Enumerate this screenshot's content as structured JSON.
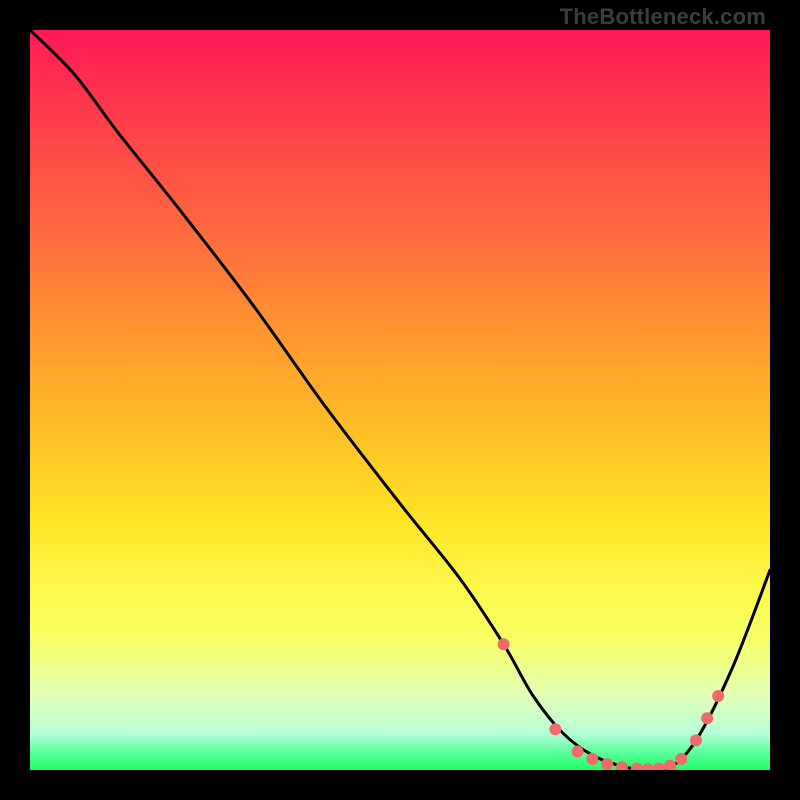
{
  "watermark": "TheBottleneck.com",
  "chart_data": {
    "type": "line",
    "title": "",
    "xlabel": "",
    "ylabel": "",
    "xlim": [
      0,
      100
    ],
    "ylim": [
      0,
      100
    ],
    "grid": false,
    "legend": false,
    "series": [
      {
        "name": "bottleneck-curve",
        "color": "#000000",
        "x": [
          0,
          6,
          12,
          20,
          30,
          40,
          50,
          58,
          64,
          68,
          72,
          76,
          80,
          83,
          86,
          90,
          95,
          100
        ],
        "values": [
          100,
          94,
          86,
          76,
          63,
          49,
          36,
          26,
          17,
          10,
          5,
          2,
          0.5,
          0,
          0,
          4,
          14,
          27
        ]
      }
    ],
    "markers": {
      "name": "highlighted-points",
      "color": "#f06a6a",
      "radius": 6,
      "points": [
        {
          "x": 64,
          "y": 17
        },
        {
          "x": 71,
          "y": 5.5
        },
        {
          "x": 74,
          "y": 2.5
        },
        {
          "x": 76,
          "y": 1.5
        },
        {
          "x": 78,
          "y": 0.8
        },
        {
          "x": 80,
          "y": 0.4
        },
        {
          "x": 82,
          "y": 0.2
        },
        {
          "x": 83.5,
          "y": 0.1
        },
        {
          "x": 85,
          "y": 0.2
        },
        {
          "x": 86.5,
          "y": 0.6
        },
        {
          "x": 88,
          "y": 1.5
        },
        {
          "x": 90,
          "y": 4
        },
        {
          "x": 91.5,
          "y": 7
        },
        {
          "x": 93,
          "y": 10
        }
      ]
    }
  }
}
